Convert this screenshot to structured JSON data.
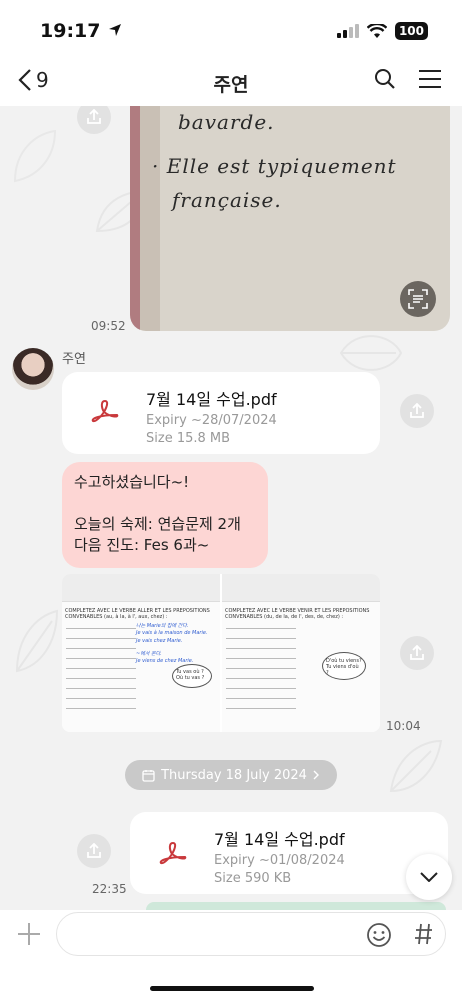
{
  "status_bar": {
    "time": "19:17",
    "battery": "100"
  },
  "header": {
    "back_count": "9",
    "title": "주연"
  },
  "messages": {
    "photo": {
      "lines": [
        "bavarde.",
        "· Elle est typiquement",
        "française."
      ],
      "time": "09:52"
    },
    "sender_name": "주연",
    "file1": {
      "name": "7월 14일 수업.pdf",
      "expiry": "Expiry  ~28/07/2024",
      "size": "Size  15.8 MB"
    },
    "text_bubble": {
      "line1": "수고하셨습니다~!",
      "line2": "",
      "line3": "오늘의 숙제: 연습문제 2개",
      "line4": "다음 진도: Fes 6과~"
    },
    "worksheets": {
      "left_heading": "COMPLETEZ AVEC LE VERBE ALLER ET LES PREPOSITIONS CONVENABLES (au, à la, à l', aux, chez) :",
      "left_blue1": "나는 Marie의 집에 간다.",
      "left_blue2": "Je vais à la maison de Marie.",
      "left_blue3": "Je vais chez Marie.",
      "left_blue4": "~에서 온다.",
      "left_blue5": "Je viens de chez Marie.",
      "left_cloud": "Tu vas où ? Où tu vas ?",
      "right_heading": "COMPLETEZ AVEC LE VERBE VENIR ET LES PREPOSITIONS CONVENABLES (du, de la, de l', des, de, chez) :",
      "right_cloud": "D'où tu viens? Tu viens d'où ?",
      "time": "10:04"
    },
    "date_separator": "Thursday 18 July 2024",
    "file2": {
      "name": "7월 14일 수업.pdf",
      "expiry": "Expiry  ~01/08/2024",
      "size": "Size  590 KB",
      "time": "22:35"
    }
  },
  "colors": {
    "bubble_pink": "#fdd6d4",
    "pdf_icon": "#c9393c",
    "background": "#f2f2f2"
  },
  "icons": [
    "location-arrow-icon",
    "signal-icon",
    "wifi-icon",
    "back-chevron-icon",
    "search-icon",
    "menu-icon",
    "share-icon",
    "scan-text-icon",
    "pdf-icon",
    "calendar-icon",
    "chevron-right-icon",
    "chevron-down-icon",
    "plus-icon",
    "emoji-icon",
    "hash-icon",
    "leaf-icon"
  ]
}
